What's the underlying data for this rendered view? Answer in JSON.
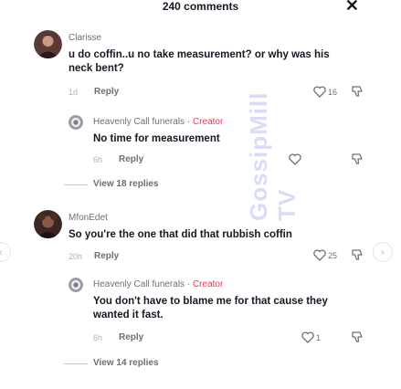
{
  "header": {
    "title": "240 comments"
  },
  "comments": [
    {
      "author": "Clarisse",
      "text": "u do coffin..u no take measurement? or why was his neck bent?",
      "time": "1d",
      "reply_label": "Reply",
      "likes": "16",
      "replies": [
        {
          "author": "Heavenly Call funerals",
          "creator_label": "Creator",
          "text": "No time for measurement",
          "time": "6h",
          "reply_label": "Reply",
          "likes": ""
        }
      ],
      "view_replies": "View 18 replies"
    },
    {
      "author": "MfonEdet",
      "text": "So you're the one that did that rubbish coffin",
      "time": "20h",
      "reply_label": "Reply",
      "likes": "25",
      "replies": [
        {
          "author": "Heavenly Call funerals",
          "creator_label": "Creator",
          "text": "You don't have to blame me for that cause they wanted it fast.",
          "time": "6h",
          "reply_label": "Reply",
          "likes": "1"
        }
      ],
      "view_replies": "View 14 replies"
    }
  ],
  "watermark": "GossipMill TV",
  "colors": {
    "creator": "#fe2c55",
    "text": "#161823",
    "muted": "#6e6e73"
  },
  "icons": [
    "close-icon",
    "heart-icon",
    "dislike-icon",
    "chevron-left-icon",
    "chevron-right-icon"
  ]
}
